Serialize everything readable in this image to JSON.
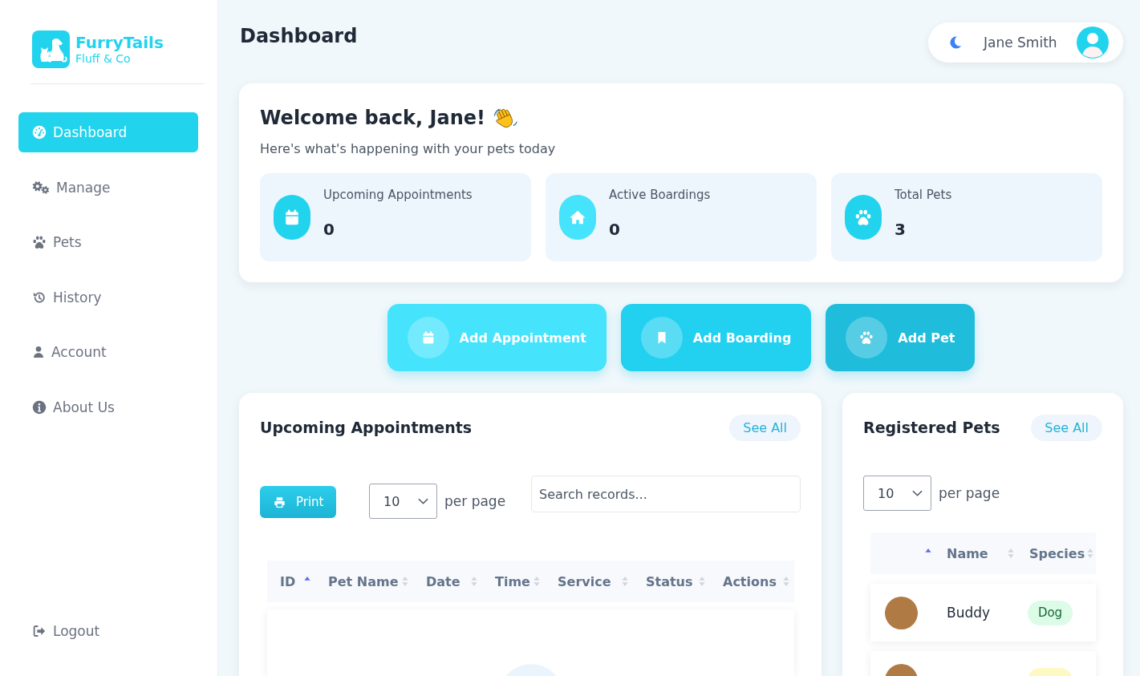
{
  "sidebar": {
    "brand": {
      "name": "FurryTails",
      "tagline": "Fluff & Co"
    },
    "items": [
      {
        "label": "Dashboard",
        "selected": true
      },
      {
        "label": "Manage",
        "selected": false
      },
      {
        "label": "Pets",
        "selected": false
      },
      {
        "label": "History",
        "selected": false
      },
      {
        "label": "Account",
        "selected": false
      },
      {
        "label": "About Us",
        "selected": false
      }
    ],
    "logout": {
      "label": "Logout"
    }
  },
  "header": {
    "title": "Dashboard",
    "user": {
      "name": "Jane Smith"
    }
  },
  "welcome": {
    "title": "Welcome back, Jane!",
    "subtitle": "Here's what's happening with your pets today",
    "stats": [
      {
        "label": "Upcoming Appointments",
        "value": "0",
        "color": "#22d3ee"
      },
      {
        "label": "Active Boardings",
        "value": "0",
        "color": "#45e3fc"
      },
      {
        "label": "Total Pets",
        "value": "3",
        "color": "#22d3ee"
      }
    ]
  },
  "actions": [
    {
      "label": "Add Appointment",
      "color": "#45e3fc"
    },
    {
      "label": "Add Boarding",
      "color": "#22d0f0"
    },
    {
      "label": "Add Pet",
      "color": "#1fbcdc"
    }
  ],
  "appointments": {
    "title": "Upcoming Appointments",
    "see_all": "See All",
    "print": "Print",
    "page_size": "10",
    "page_size_label": "per page",
    "search": {
      "placeholder": "Search records..."
    },
    "columns": [
      {
        "label": "ID",
        "sorted": true
      },
      {
        "label": "Pet Name",
        "sorted": false
      },
      {
        "label": "Date",
        "sorted": false
      },
      {
        "label": "Time",
        "sorted": false
      },
      {
        "label": "Service",
        "sorted": false
      },
      {
        "label": "Status",
        "sorted": false
      },
      {
        "label": "Actions",
        "sorted": false
      }
    ]
  },
  "pets": {
    "title": "Registered Pets",
    "see_all": "See All",
    "page_size": "10",
    "page_size_label": "per page",
    "columns": [
      {
        "sorted": true
      },
      {
        "label": "Name",
        "sorted": false
      },
      {
        "label": "Species",
        "sorted": false
      }
    ],
    "rows": [
      {
        "name": "Buddy",
        "species": "Dog",
        "color": "#dcfce7"
      },
      {
        "color": "#fef9c3"
      }
    ]
  }
}
